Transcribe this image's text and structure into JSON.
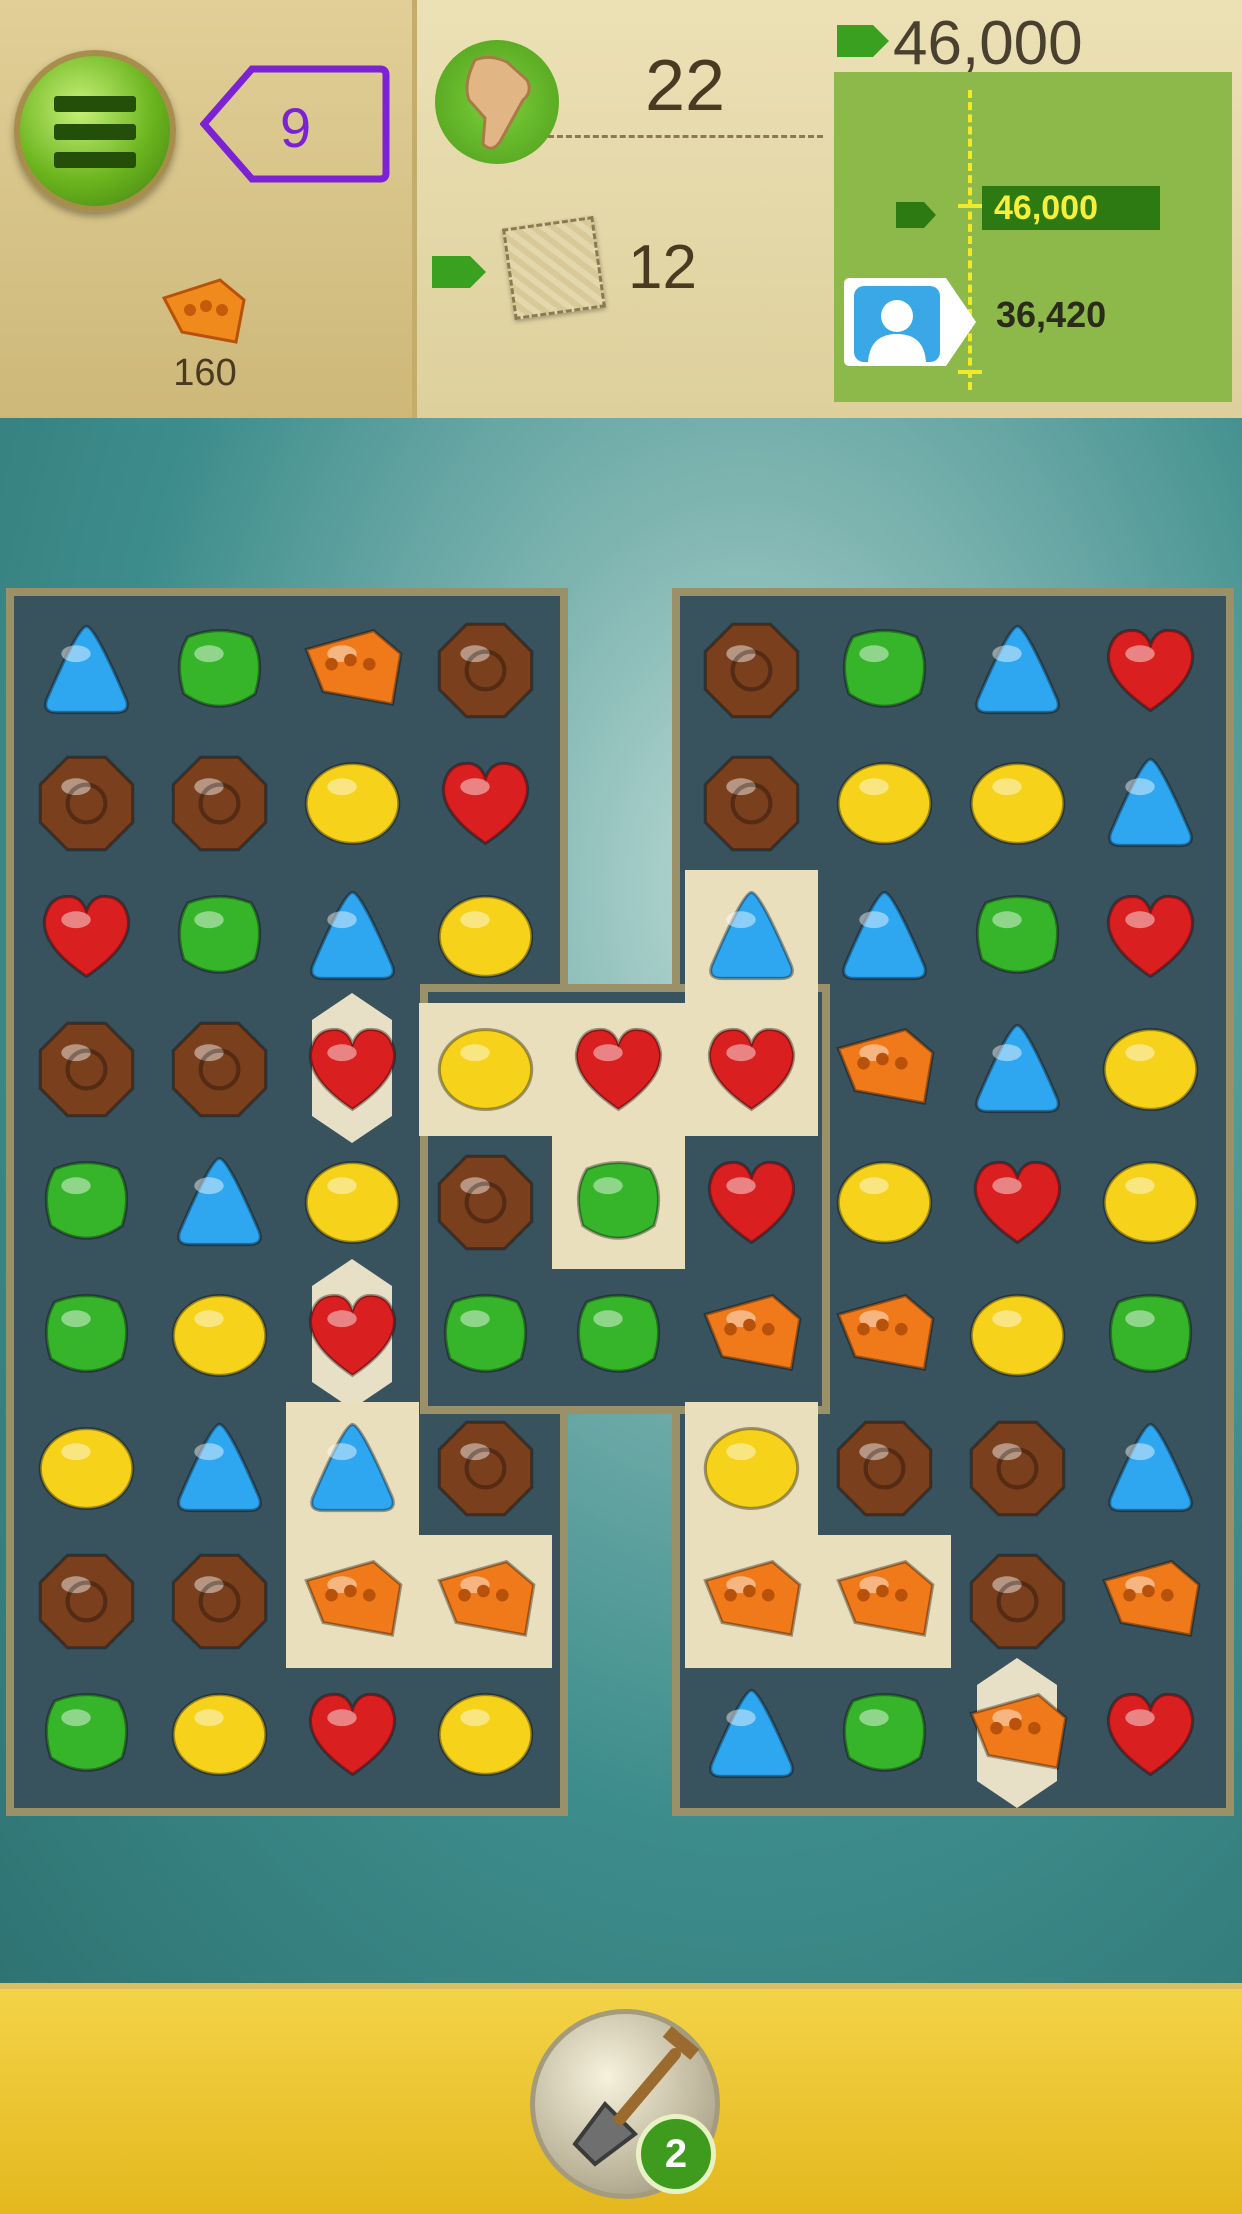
{
  "hud": {
    "moves_left": "9",
    "target_count": "160",
    "swipe_count": "22",
    "tiles_left": "12",
    "target_score": "46,000",
    "goal_score": "46,000",
    "player_score": "36,420"
  },
  "icons": {
    "menu": "hamburger-menu-icon",
    "target": "cheese-candy-icon",
    "hand": "pointing-hand-icon",
    "tile": "cloth-tile-icon",
    "avatar": "player-avatar-icon",
    "booster": "shovel-icon"
  },
  "booster": {
    "count": "2"
  },
  "colors": {
    "blue": "#2ea6f0",
    "green": "#36b52a",
    "orange": "#f07a1a",
    "brown": "#7a3f1c",
    "yellow": "#f6d21a",
    "red": "#d91f1f",
    "board": "#38525e",
    "stone": "#e9dfbd"
  },
  "board": {
    "legend": {
      "B": "blue",
      "G": "green",
      "O": "orange",
      "N": "brown",
      "Y": "yellow",
      "R": "red",
      "X": "gap"
    },
    "rows": [
      [
        "B",
        "G",
        "O",
        "N",
        "X",
        "N",
        "G",
        "B",
        "R"
      ],
      [
        "N",
        "N",
        "Y",
        "R",
        "X",
        "N",
        "Y",
        "Y",
        "B"
      ],
      [
        "R",
        "G",
        "B",
        "Y",
        "X",
        "B",
        "B",
        "G",
        "R"
      ],
      [
        "N",
        "N",
        "R",
        "Y",
        "R",
        "R",
        "O",
        "B",
        "Y"
      ],
      [
        "G",
        "B",
        "Y",
        "N",
        "G",
        "R",
        "Y",
        "R",
        "Y"
      ],
      [
        "G",
        "Y",
        "R",
        "G",
        "G",
        "O",
        "O",
        "Y",
        "G"
      ],
      [
        "Y",
        "B",
        "B",
        "N",
        "X",
        "Y",
        "N",
        "N",
        "B"
      ],
      [
        "N",
        "N",
        "O",
        "O",
        "X",
        "O",
        "O",
        "N",
        "O"
      ],
      [
        "G",
        "Y",
        "R",
        "Y",
        "X",
        "B",
        "G",
        "O",
        "R"
      ]
    ],
    "stone_cells": [
      [
        2,
        5
      ],
      [
        3,
        3
      ],
      [
        3,
        4
      ],
      [
        3,
        5
      ],
      [
        4,
        4
      ],
      [
        6,
        2
      ],
      [
        6,
        5
      ],
      [
        7,
        2
      ],
      [
        7,
        3
      ],
      [
        7,
        5
      ],
      [
        7,
        6
      ]
    ],
    "locked_cells": [
      [
        3,
        2
      ],
      [
        5,
        2
      ],
      [
        8,
        7
      ]
    ]
  }
}
